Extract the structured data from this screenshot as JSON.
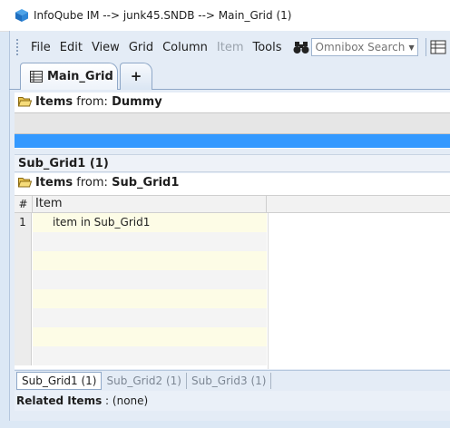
{
  "window": {
    "title": "InfoQube IM --> junk45.SNDB --> Main_Grid (1)"
  },
  "menu": {
    "file": "File",
    "edit": "Edit",
    "view": "View",
    "grid": "Grid",
    "column": "Column",
    "item": "Item",
    "tools": "Tools"
  },
  "omnibox": {
    "placeholder": "Omnibox Search..."
  },
  "tabs": {
    "main_label": "Main_Grid",
    "add_label": "+"
  },
  "main_pane": {
    "items_from_label": "Items",
    "from_word": "from:",
    "source": "Dummy"
  },
  "subgrid": {
    "title": "Sub_Grid1 (1)",
    "items_from_label": "Items",
    "from_word": "from:",
    "source": "Sub_Grid1",
    "columns": {
      "num": "#",
      "item": "Item"
    },
    "rows": [
      {
        "num": "1",
        "text": "item in Sub_Grid1"
      }
    ]
  },
  "bottom_tabs": [
    "Sub_Grid1 (1)",
    "Sub_Grid2 (1)",
    "Sub_Grid3 (1)"
  ],
  "related": {
    "label": "Related Items",
    "sep": ":",
    "value": "(none)"
  },
  "colors": {
    "selection": "#3399ff",
    "frame": "#dce8f5",
    "row_highlight": "#fdfce6"
  }
}
